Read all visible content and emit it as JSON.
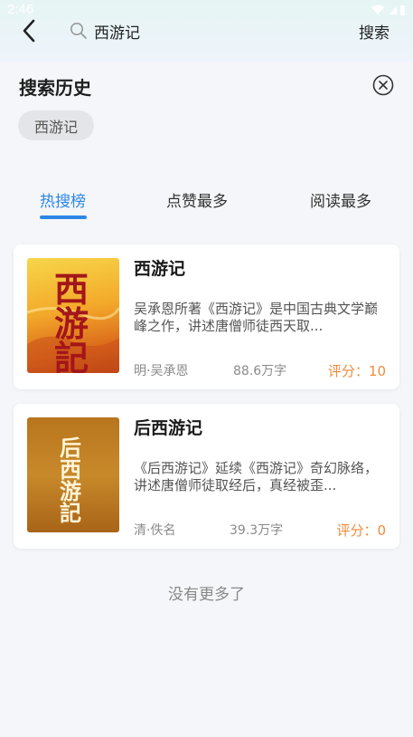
{
  "status": {
    "time": "2:46"
  },
  "search": {
    "value": "西游记",
    "button": "搜索"
  },
  "history": {
    "title": "搜索历史",
    "items": [
      "西游记"
    ]
  },
  "tabs": [
    "热搜榜",
    "点赞最多",
    "阅读最多"
  ],
  "books": [
    {
      "title": "西游记",
      "desc": "吴承恩所著《西游记》是中国古典文学巅峰之作，讲述唐僧师徒西天取...",
      "author": "明·吴承恩",
      "words": "88.6万字",
      "score": "评分：10",
      "cover_chars": [
        "西",
        "游",
        "記"
      ]
    },
    {
      "title": "后西游记",
      "desc": "《后西游记》延续《西游记》奇幻脉络，讲述唐僧师徒取经后，真经被歪...",
      "author": "清·佚名",
      "words": "39.3万字",
      "score": "评分：0",
      "cover_chars": [
        "后",
        "西",
        "游",
        "記"
      ]
    }
  ],
  "footer": {
    "no_more": "没有更多了"
  },
  "colors": {
    "accent": "#2d86e6",
    "score": "#f08a3c"
  }
}
